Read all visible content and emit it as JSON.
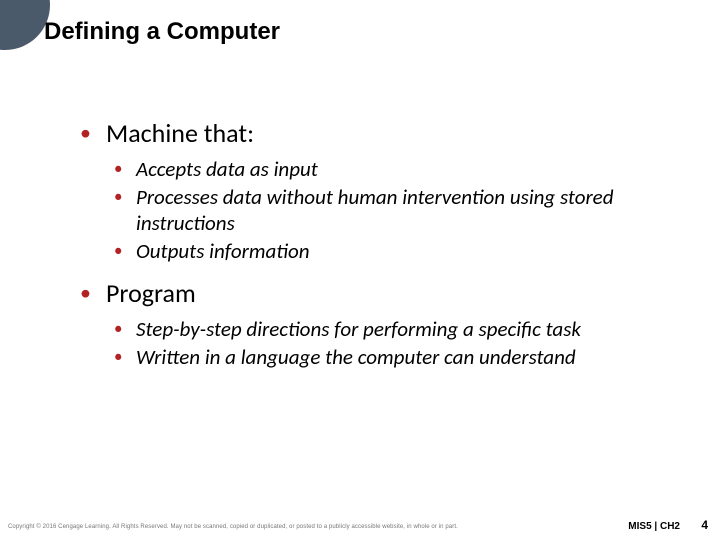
{
  "title": "Defining a Computer",
  "bullets": {
    "b1": {
      "label": "Machine that:"
    },
    "b1_sub": {
      "s1": "Accepts data as input",
      "s2": "Processes data without human intervention using stored instructions",
      "s3": "Outputs information"
    },
    "b2": {
      "label": "Program"
    },
    "b2_sub": {
      "s1": "Step-by-step directions for performing a specific task",
      "s2": "Written in a language the computer can understand"
    }
  },
  "copyright": "Copyright © 2016 Cengage Learning. All Rights Reserved. May not be scanned, copied or duplicated, or posted to a publicly accessible website, in whole or in part.",
  "footer_code": "MIS5 | CH2",
  "page_number": "4"
}
